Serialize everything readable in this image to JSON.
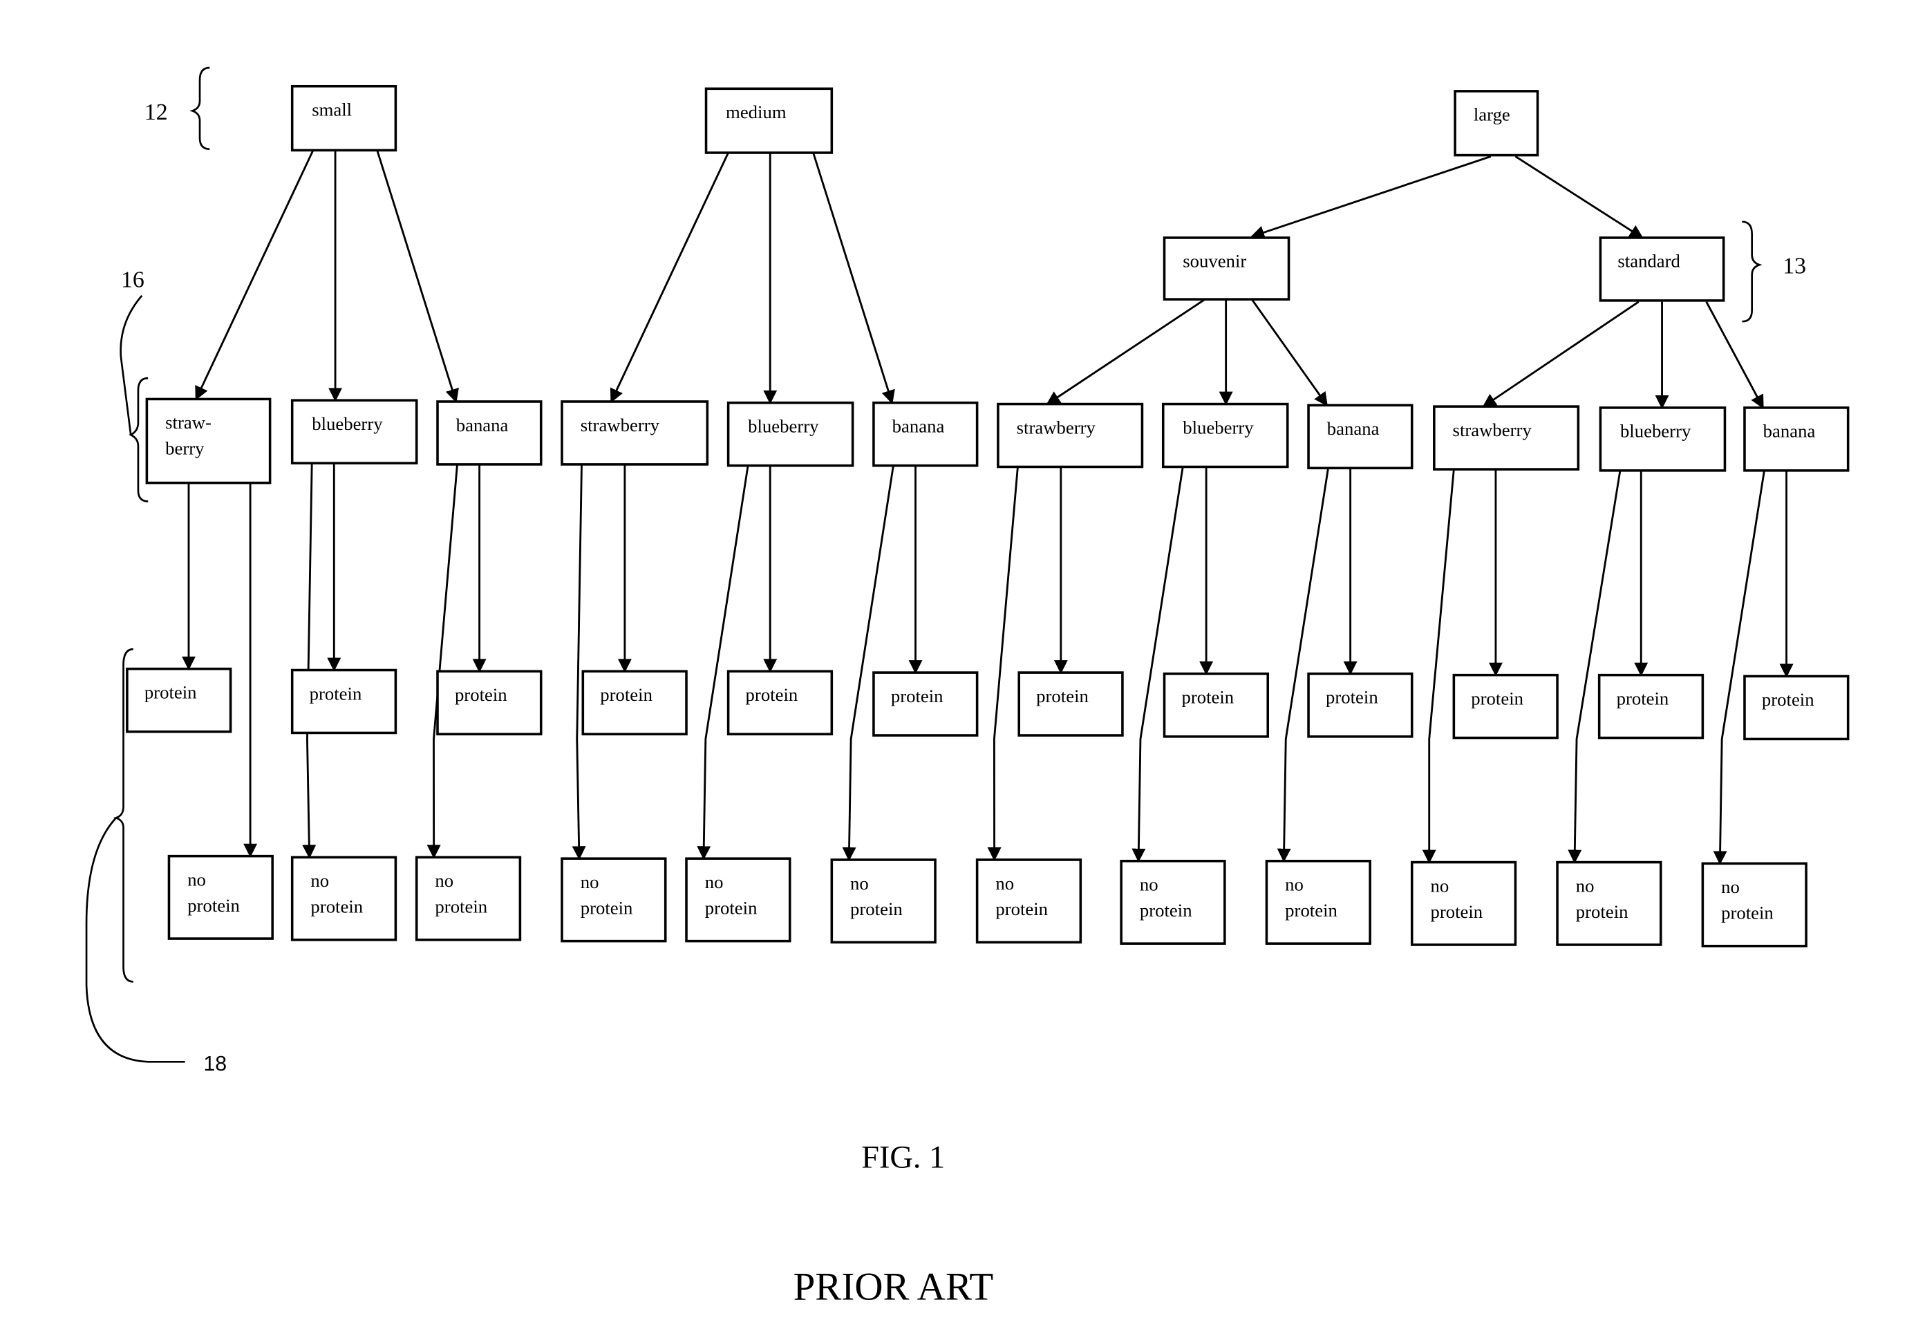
{
  "diagram": {
    "sizes": [
      "small",
      "medium",
      "large"
    ],
    "large_types": [
      "souvenir",
      "standard"
    ],
    "flavors": [
      "strawberry",
      "blueberry",
      "banana"
    ],
    "first_flavor_wrapped": [
      "straw-",
      "berry"
    ],
    "protein_label": "protein",
    "no_protein_label": [
      "no",
      "protein"
    ],
    "reference_numerals": {
      "sizes": "12",
      "types": "13",
      "flavors": "16",
      "protein": "18"
    }
  },
  "caption": {
    "figure": "FIG. 1",
    "note": "PRIOR ART"
  }
}
